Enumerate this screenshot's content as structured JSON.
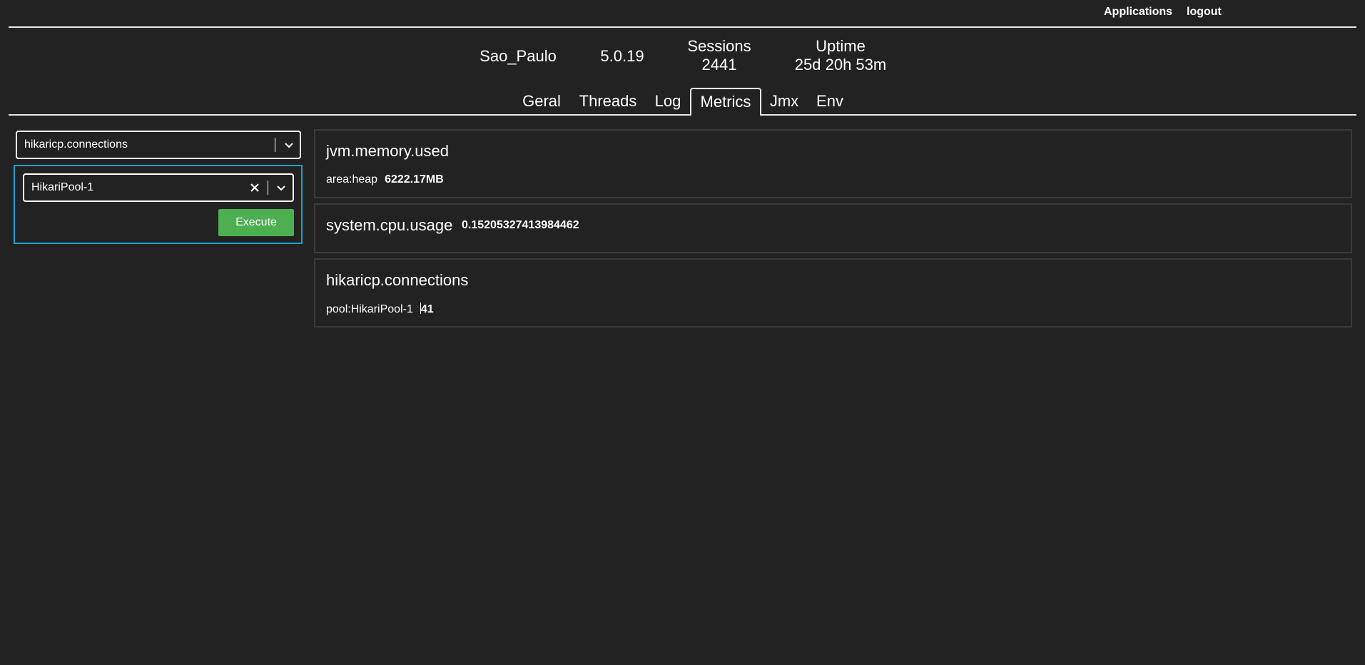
{
  "topnav": {
    "applications_label": "Applications",
    "logout_label": "logout"
  },
  "info": {
    "instance_name": "Sao_Paulo",
    "version": "5.0.19",
    "sessions_label": "Sessions",
    "sessions_value": "2441",
    "uptime_label": "Uptime",
    "uptime_value": "25d 20h 53m"
  },
  "tabs": [
    {
      "label": "Geral",
      "active": false
    },
    {
      "label": "Threads",
      "active": false
    },
    {
      "label": "Log",
      "active": false
    },
    {
      "label": "Metrics",
      "active": true
    },
    {
      "label": "Jmx",
      "active": false
    },
    {
      "label": "Env",
      "active": false
    }
  ],
  "sidebar": {
    "metric_select_value": "hikaricp.connections",
    "tag_select_value": "HikariPool-1",
    "execute_label": "Execute"
  },
  "metrics": [
    {
      "name": "jvm.memory.used",
      "tag": "area:heap",
      "value": "6222.17MB"
    },
    {
      "name": "system.cpu.usage",
      "value": "0.15205327413984462"
    },
    {
      "name": "hikaricp.connections",
      "tag": "pool:HikariPool-1",
      "value": "41"
    }
  ],
  "colors": {
    "background": "#222222",
    "accent_border": "#1e9ecf",
    "execute_button": "#4caf50",
    "card_border": "#3a3a3a"
  },
  "icons": {
    "dropdown": "chevron-down-icon",
    "clear": "close-icon"
  }
}
